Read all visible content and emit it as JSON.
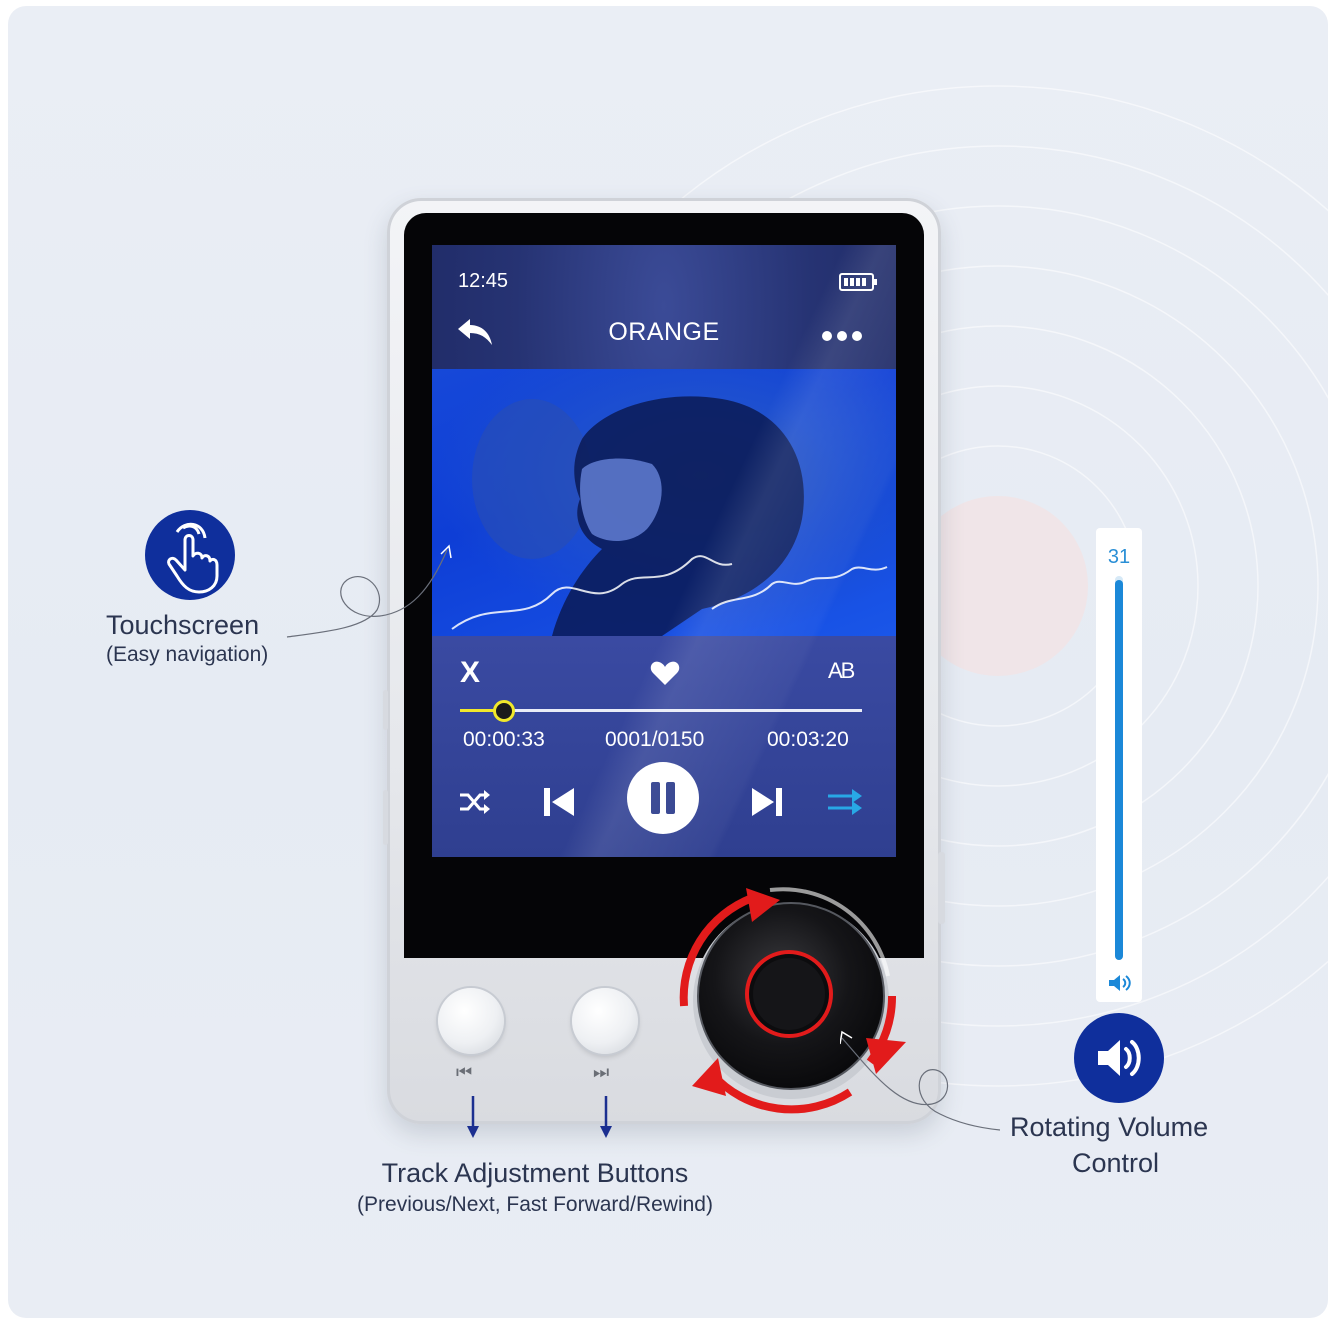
{
  "screen": {
    "status_time": "12:45",
    "song_title": "ORANGE",
    "close_label": "X",
    "ab_label": "AB",
    "elapsed_time": "00:00:33",
    "track_index": "0001/0150",
    "total_time": "00:03:20",
    "progress_fraction": 0.11,
    "icons": [
      "battery-icon",
      "back-arrow-icon",
      "more-dots-icon",
      "heart-icon",
      "shuffle-icon",
      "previous-track-icon",
      "pause-icon",
      "next-track-icon",
      "repeat-icon"
    ]
  },
  "hardware": {
    "left_button_glyph": "⏮",
    "right_button_glyph": "⏭",
    "knob_accent_color": "#e21b1b"
  },
  "callouts": {
    "touchscreen_title": "Touchscreen",
    "touchscreen_sub": "(Easy navigation)",
    "track_buttons_title": "Track Adjustment Buttons",
    "track_buttons_sub": "(Previous/Next, Fast Forward/Rewind)",
    "volume_title_line1": "Rotating Volume",
    "volume_title_line2": "Control"
  },
  "volume": {
    "value": "31",
    "level_fraction": 0.99
  },
  "colors": {
    "accent_blue": "#0f2f9c",
    "progress_yellow": "#f1e82b",
    "volume_blue": "#1b88d8",
    "arrow_red": "#e21b1b"
  }
}
